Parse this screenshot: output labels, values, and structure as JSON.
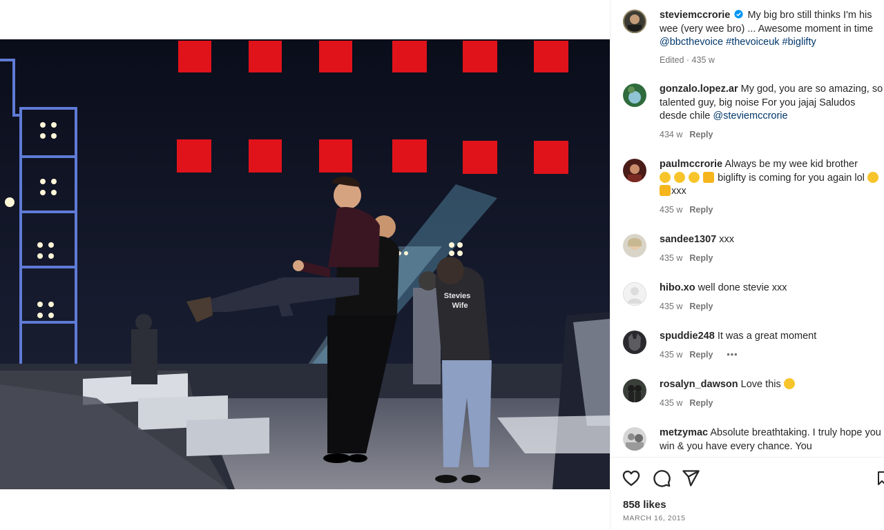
{
  "post": {
    "author": "steviemccrorie",
    "caption_text": "My big bro still thinks I'm his wee (very wee bro) ... Awesome moment in time",
    "caption_mention": "@bbcthevoice",
    "caption_tags": "#thevoiceuk #biglifty",
    "edited_meta": "Edited · 435 w",
    "shirt_text_line1": "Stevies",
    "shirt_text_line2": "Wife"
  },
  "comments": [
    {
      "user": "gonzalo.lopez.ar",
      "text": "My god, you are so amazing, so talented guy, big noise For you jajaj Saludos desde chile",
      "mention": "@steviemccrorie",
      "time": "434 w",
      "reply": "Reply"
    },
    {
      "user": "paulmccrorie",
      "text": "Always be my wee kid brother",
      "text2": "biglifty is coming for you again lol",
      "text3": "xxx",
      "time": "435 w",
      "reply": "Reply"
    },
    {
      "user": "sandee1307",
      "text": "xxx",
      "time": "435 w",
      "reply": "Reply"
    },
    {
      "user": "hibo.xo",
      "text": "well done stevie xxx",
      "time": "435 w",
      "reply": "Reply"
    },
    {
      "user": "spuddie248",
      "text": "It was a great moment",
      "time": "435 w",
      "reply": "Reply",
      "more": "•••"
    },
    {
      "user": "rosalyn_dawson",
      "text": "Love this",
      "time": "435 w",
      "reply": "Reply"
    },
    {
      "user": "metzymac",
      "text": "Absolute breathtaking. I truly hope you win & you have every chance. You"
    }
  ],
  "footer": {
    "likes": "858 likes",
    "date": "MARCH 16, 2015"
  },
  "icons": {
    "like": "heart-icon",
    "comment": "comment-icon",
    "share": "share-icon",
    "save": "bookmark-icon",
    "verified": "verified-badge-icon"
  },
  "colors": {
    "text": "#262626",
    "muted": "#737373",
    "link": "#00376b",
    "verified": "#0095f6"
  }
}
